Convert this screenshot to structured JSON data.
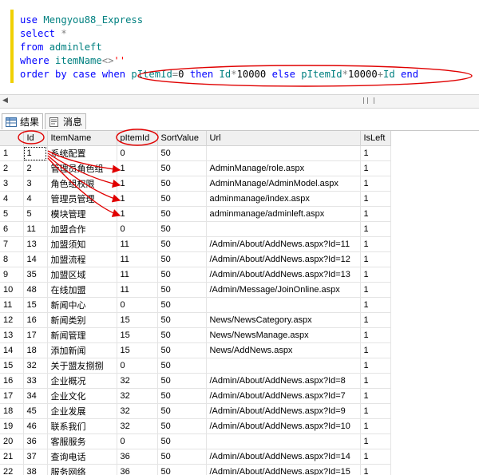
{
  "query": {
    "lines": [
      [
        {
          "t": "use ",
          "c": "kw"
        },
        {
          "t": "Mengyou88_Express",
          "c": "id"
        }
      ],
      [
        {
          "t": "select ",
          "c": "kw"
        },
        {
          "t": "*",
          "c": "op"
        }
      ],
      [
        {
          "t": "from ",
          "c": "kw"
        },
        {
          "t": "adminleft",
          "c": "id"
        }
      ],
      [
        {
          "t": "where ",
          "c": "kw"
        },
        {
          "t": "itemName",
          "c": "id"
        },
        {
          "t": "<>",
          "c": "op"
        },
        {
          "t": "''",
          "c": "str"
        }
      ],
      [
        {
          "t": "order by case when ",
          "c": "kw"
        },
        {
          "t": "pItemId",
          "c": "id"
        },
        {
          "t": "=",
          "c": "op"
        },
        {
          "t": "0 ",
          "c": "num"
        },
        {
          "t": "then ",
          "c": "kw"
        },
        {
          "t": "Id",
          "c": "id"
        },
        {
          "t": "*",
          "c": "op"
        },
        {
          "t": "10000 ",
          "c": "num"
        },
        {
          "t": "else ",
          "c": "kw"
        },
        {
          "t": "pItemId",
          "c": "id"
        },
        {
          "t": "*",
          "c": "op"
        },
        {
          "t": "10000",
          "c": "num"
        },
        {
          "t": "+",
          "c": "op"
        },
        {
          "t": "Id ",
          "c": "id"
        },
        {
          "t": "end",
          "c": "kw"
        }
      ]
    ]
  },
  "tabs": {
    "results_label": "结果",
    "messages_label": "消息"
  },
  "grid": {
    "columns": [
      "",
      "Id",
      "ItemName",
      "pItemId",
      "SortValue",
      "Url",
      "IsLeft"
    ],
    "rows": [
      [
        "1",
        "1",
        "系统配置",
        "0",
        "50",
        "",
        "1"
      ],
      [
        "2",
        "2",
        "管理员角色组",
        "1",
        "50",
        "AdminManage/role.aspx",
        "1"
      ],
      [
        "3",
        "3",
        "角色组权限",
        "1",
        "50",
        "AdminManage/AdminModel.aspx",
        "1"
      ],
      [
        "4",
        "4",
        "管理员管理",
        "1",
        "50",
        "adminmanage/index.aspx",
        "1"
      ],
      [
        "5",
        "5",
        "模块管理",
        "1",
        "50",
        "adminmanage/adminleft.aspx",
        "1"
      ],
      [
        "6",
        "11",
        "加盟合作",
        "0",
        "50",
        "",
        "1"
      ],
      [
        "7",
        "13",
        "加盟须知",
        "11",
        "50",
        "/Admin/About/AddNews.aspx?Id=11",
        "1"
      ],
      [
        "8",
        "14",
        "加盟流程",
        "11",
        "50",
        "/Admin/About/AddNews.aspx?Id=12",
        "1"
      ],
      [
        "9",
        "35",
        "加盟区域",
        "11",
        "50",
        "/Admin/About/AddNews.aspx?Id=13",
        "1"
      ],
      [
        "10",
        "48",
        "在线加盟",
        "11",
        "50",
        "/Admin/Message/JoinOnline.aspx",
        "1"
      ],
      [
        "11",
        "15",
        "新闻中心",
        "0",
        "50",
        "",
        "1"
      ],
      [
        "12",
        "16",
        "新闻类别",
        "15",
        "50",
        "News/NewsCategory.aspx",
        "1"
      ],
      [
        "13",
        "17",
        "新闻管理",
        "15",
        "50",
        "News/NewsManage.aspx",
        "1"
      ],
      [
        "14",
        "18",
        "添加新闻",
        "15",
        "50",
        "News/AddNews.aspx",
        "1"
      ],
      [
        "15",
        "32",
        "关于盟友捌捌",
        "0",
        "50",
        "",
        "1"
      ],
      [
        "16",
        "33",
        "企业概况",
        "32",
        "50",
        "/Admin/About/AddNews.aspx?Id=8",
        "1"
      ],
      [
        "17",
        "34",
        "企业文化",
        "32",
        "50",
        "/Admin/About/AddNews.aspx?Id=7",
        "1"
      ],
      [
        "18",
        "45",
        "企业发展",
        "32",
        "50",
        "/Admin/About/AddNews.aspx?Id=9",
        "1"
      ],
      [
        "19",
        "46",
        "联系我们",
        "32",
        "50",
        "/Admin/About/AddNews.aspx?Id=10",
        "1"
      ],
      [
        "20",
        "36",
        "客服服务",
        "0",
        "50",
        "",
        "1"
      ],
      [
        "21",
        "37",
        "查询电话",
        "36",
        "50",
        "/Admin/About/AddNews.aspx?Id=14",
        "1"
      ],
      [
        "22",
        "38",
        "服务网络",
        "36",
        "50",
        "/Admin/About/AddNews.aspx?Id=15",
        "1"
      ]
    ]
  }
}
